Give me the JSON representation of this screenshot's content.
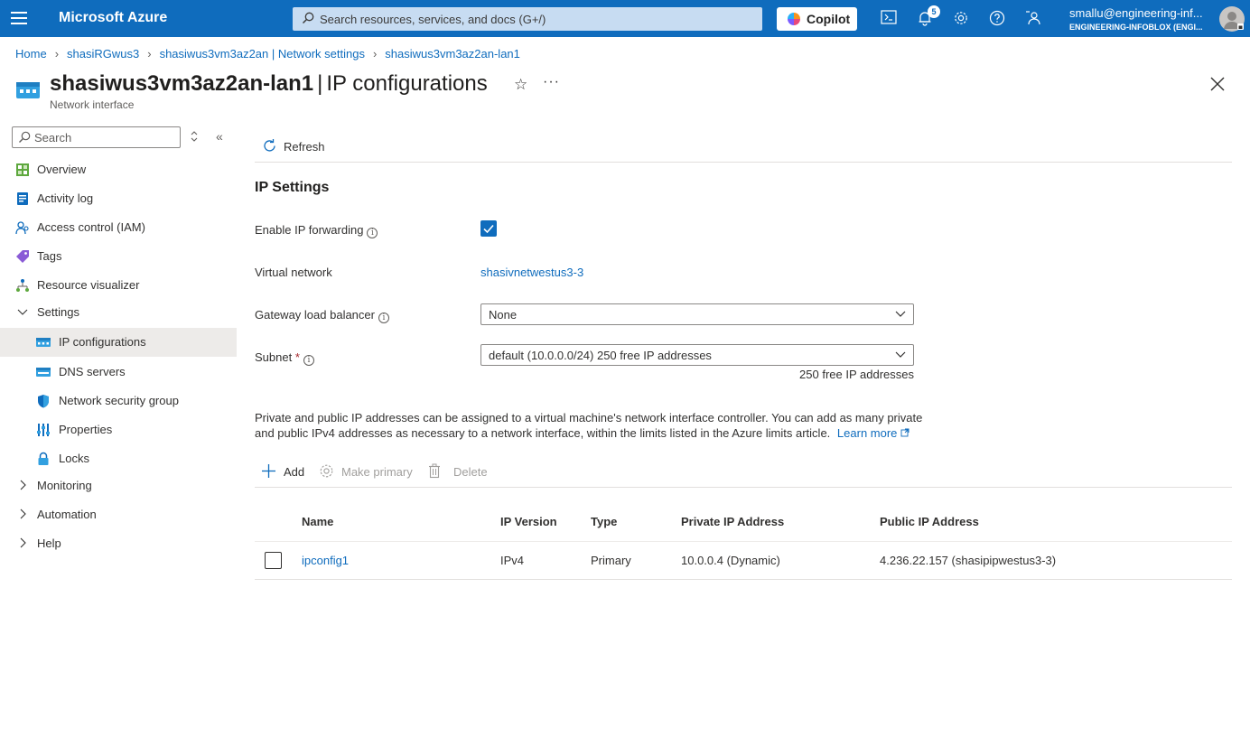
{
  "topbar": {
    "brand": "Microsoft Azure",
    "search_placeholder": "Search resources, services, and docs (G+/)",
    "copilot_label": "Copilot",
    "notification_count": "5",
    "account_email": "smallu@engineering-inf...",
    "account_directory": "ENGINEERING-INFOBLOX (ENGI...",
    "color": "#0f6cbd"
  },
  "breadcrumb": [
    "Home",
    "shasiRGwus3",
    "shasiwus3vm3az2an | Network settings",
    "shasiwus3vm3az2an-lan1"
  ],
  "header": {
    "resource_name": "shasiwus3vm3az2an-lan1",
    "page_name": "IP configurations",
    "resource_type": "Network interface"
  },
  "nav": {
    "search_placeholder": "Search",
    "items": [
      {
        "label": "Overview",
        "icon": "overview-icon"
      },
      {
        "label": "Activity log",
        "icon": "activity-log-icon"
      },
      {
        "label": "Access control (IAM)",
        "icon": "iam-icon"
      },
      {
        "label": "Tags",
        "icon": "tag-icon"
      },
      {
        "label": "Resource visualizer",
        "icon": "visualizer-icon"
      },
      {
        "label": "Settings",
        "icon": "chevron-down-icon"
      },
      {
        "label": "IP configurations",
        "icon": "nic-icon"
      },
      {
        "label": "DNS servers",
        "icon": "dns-icon"
      },
      {
        "label": "Network security group",
        "icon": "shield-icon"
      },
      {
        "label": "Properties",
        "icon": "properties-icon"
      },
      {
        "label": "Locks",
        "icon": "lock-icon"
      },
      {
        "label": "Monitoring",
        "icon": "chevron-right-icon"
      },
      {
        "label": "Automation",
        "icon": "chevron-right-icon"
      },
      {
        "label": "Help",
        "icon": "chevron-right-icon"
      }
    ]
  },
  "toolbar": {
    "refresh": "Refresh"
  },
  "ip_settings": {
    "title": "IP Settings",
    "ip_forwarding_label": "Enable IP forwarding",
    "ip_forwarding_checked": true,
    "vnet_label": "Virtual network",
    "vnet_value": "shasivnetwestus3-3",
    "gwlb_label": "Gateway load balancer",
    "gwlb_value": "None",
    "subnet_label": "Subnet",
    "subnet_required": "*",
    "subnet_value": "default (10.0.0.0/24) 250 free IP addresses",
    "subnet_free": "250 free IP addresses"
  },
  "description": {
    "text": "Private and public IP addresses can be assigned to a virtual machine's network interface controller. You can add as many private and public IPv4 addresses as necessary to a network interface, within the limits listed in the Azure limits article.",
    "link": "Learn more"
  },
  "actions": {
    "add": "Add",
    "make_primary": "Make primary",
    "delete": "Delete"
  },
  "table": {
    "headers": [
      "Name",
      "IP Version",
      "Type",
      "Private IP Address",
      "Public IP Address"
    ],
    "rows": [
      [
        "ipconfig1",
        "IPv4",
        "Primary",
        "10.0.0.4 (Dynamic)",
        "4.236.22.157 (shasipipwestus3-3)"
      ]
    ]
  }
}
